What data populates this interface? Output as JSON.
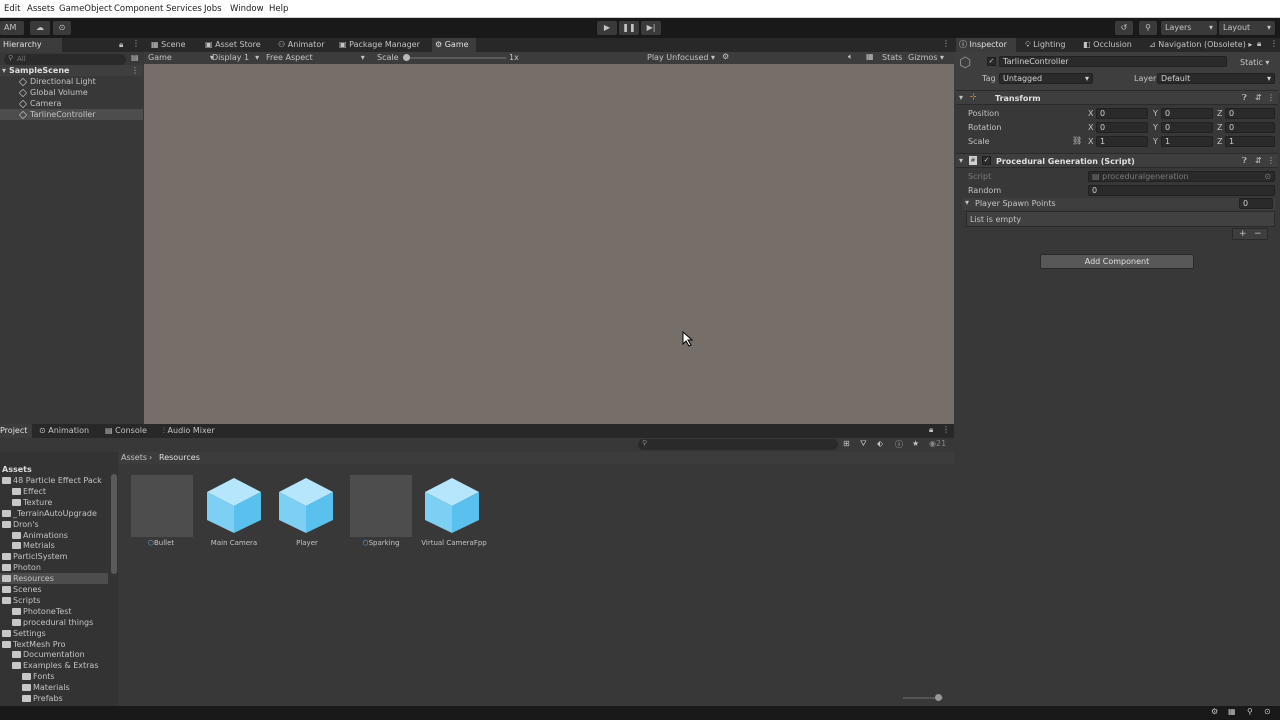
{
  "menu": [
    "Edit",
    "Assets",
    "GameObject",
    "Component",
    "Services",
    "Jobs",
    "Window",
    "Help"
  ],
  "toolbar": {
    "account": "AM",
    "layers": "Layers",
    "layout": "Layout"
  },
  "hierarchy": {
    "title": "Hierarchy",
    "search_placeholder": "All",
    "scene": "SampleScene",
    "items": [
      "Directional Light",
      "Global Volume",
      "Camera",
      "TarlineController"
    ]
  },
  "center_tabs": [
    "Scene",
    "Asset Store",
    "Animator",
    "Package Manager",
    "Game"
  ],
  "game_bar": {
    "mode": "Game",
    "display": "Display 1",
    "aspect": "Free Aspect",
    "scale_label": "Scale",
    "scale_value": "1x",
    "play_mode": "Play Unfocused",
    "stats": "Stats",
    "gizmos": "Gizmos"
  },
  "inspector": {
    "tabs": [
      "Inspector",
      "Lighting",
      "Occlusion",
      "Navigation (Obsolete)"
    ],
    "object_name": "TarlineController",
    "static_label": "Static",
    "tag_label": "Tag",
    "tag_value": "Untagged",
    "layer_label": "Layer",
    "layer_value": "Default",
    "transform": {
      "title": "Transform",
      "rows": [
        {
          "label": "Position",
          "x": "0",
          "y": "0",
          "z": "0"
        },
        {
          "label": "Rotation",
          "x": "0",
          "y": "0",
          "z": "0"
        },
        {
          "label": "Scale",
          "x": "1",
          "y": "1",
          "z": "1"
        }
      ]
    },
    "script_component": {
      "title": "Procedural Generation (Script)",
      "script_label": "Script",
      "script_value": "proceduralgeneration",
      "random_label": "Random",
      "random_value": "0",
      "spawn_label": "Player Spawn Points",
      "spawn_count": "0",
      "empty_text": "List is empty"
    },
    "add_component": "Add Component"
  },
  "bottom_tabs": [
    "Project",
    "Animation",
    "Console",
    "Audio Mixer"
  ],
  "project": {
    "root": "Assets",
    "breadcrumb": [
      "Assets",
      "Resources"
    ],
    "count": "21",
    "tree": [
      {
        "label": "48 Particle Effect Pack",
        "indent": 0
      },
      {
        "label": "Effect",
        "indent": 1
      },
      {
        "label": "Texture",
        "indent": 1
      },
      {
        "label": "_TerrainAutoUpgrade",
        "indent": 0
      },
      {
        "label": "Dron's",
        "indent": 0
      },
      {
        "label": "Animations",
        "indent": 1
      },
      {
        "label": "Metrials",
        "indent": 1
      },
      {
        "label": "ParticlSystem",
        "indent": 0
      },
      {
        "label": "Photon",
        "indent": 0
      },
      {
        "label": "Resources",
        "indent": 0
      },
      {
        "label": "Scenes",
        "indent": 0
      },
      {
        "label": "Scripts",
        "indent": 0
      },
      {
        "label": "PhotoneTest",
        "indent": 1
      },
      {
        "label": "procedural things",
        "indent": 1
      },
      {
        "label": "Settings",
        "indent": 0
      },
      {
        "label": "TextMesh Pro",
        "indent": 0
      },
      {
        "label": "Documentation",
        "indent": 1
      },
      {
        "label": "Examples & Extras",
        "indent": 1
      },
      {
        "label": "Fonts",
        "indent": 2
      },
      {
        "label": "Materials",
        "indent": 2
      },
      {
        "label": "Prefabs",
        "indent": 2
      }
    ],
    "assets": [
      {
        "label": "Bullet",
        "kind": "gray"
      },
      {
        "label": "Main Camera",
        "kind": "cube"
      },
      {
        "label": "Player",
        "kind": "cube"
      },
      {
        "label": "Sparking",
        "kind": "gray"
      },
      {
        "label": "Virtual CameraFpp",
        "kind": "cube"
      }
    ]
  }
}
